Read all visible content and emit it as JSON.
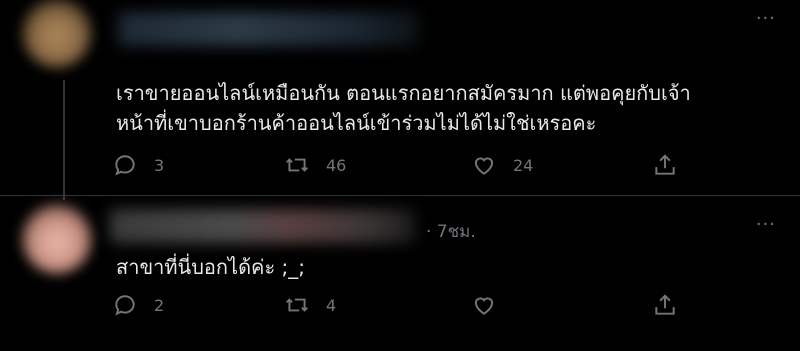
{
  "tweets": [
    {
      "text_lines": [
        "เราขายออนไลน์เหมือนกัน ตอนแรกอยากสมัครมาก แต่พอคุยกับเจ้า",
        "หน้าที่เขาบอกร้านค้าออนไลน์เข้าร่วมไม่ได้ไม่ใช่เหรอคะ"
      ],
      "replies": "3",
      "retweets": "46",
      "likes": "24",
      "more_label": "···"
    },
    {
      "timestamp": "· 7ชม.",
      "text_lines": [
        "สาขาที่นี่บอกได้ค่ะ ;_;"
      ],
      "replies": "2",
      "retweets": "4",
      "likes": "",
      "more_label": "···"
    }
  ],
  "icons": [
    "reply-icon",
    "retweet-icon",
    "like-icon",
    "share-icon"
  ],
  "colors": {
    "background": "#000000",
    "text": "#e7e9ea",
    "muted": "#71767b",
    "divider": "#2f3336"
  }
}
